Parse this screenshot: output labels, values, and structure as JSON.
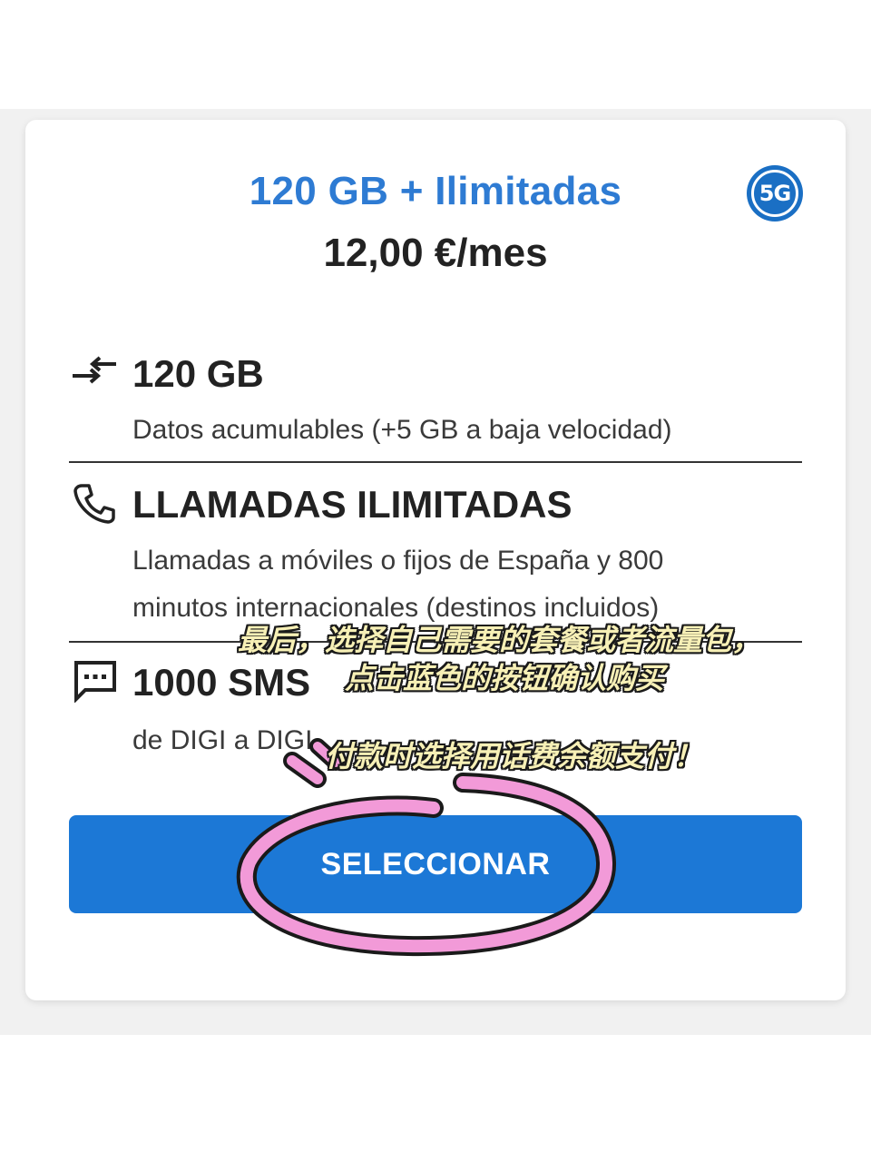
{
  "plan": {
    "name": "120 GB + Ilimitadas",
    "price": "12,00 €/mes",
    "badge": "5G"
  },
  "features": [
    {
      "icon": "data-transfer-icon",
      "title": "120 GB",
      "description": "Datos acumulables (+5 GB a baja velocidad)"
    },
    {
      "icon": "phone-icon",
      "title": "LLAMADAS ILIMITADAS",
      "description_line1": "Llamadas a móviles o fijos de España y 800",
      "description_line2": "minutos internacionales (destinos incluidos)"
    },
    {
      "icon": "sms-icon",
      "title": "1000 SMS",
      "description": "de DIGI a DIGI"
    }
  ],
  "button": {
    "label": "SELECCIONAR"
  },
  "overlay": {
    "line1": "最后，选择自己需要的套餐或者流量包，",
    "line2": "点击蓝色的按钮确认购买",
    "line3": "付款时选择用话费余额支付！"
  },
  "colors": {
    "accent": "#2e7bd3",
    "button": "#1c78d6",
    "highlight_circle": "#f29ad8",
    "overlay_text": "#f7f0b6"
  }
}
